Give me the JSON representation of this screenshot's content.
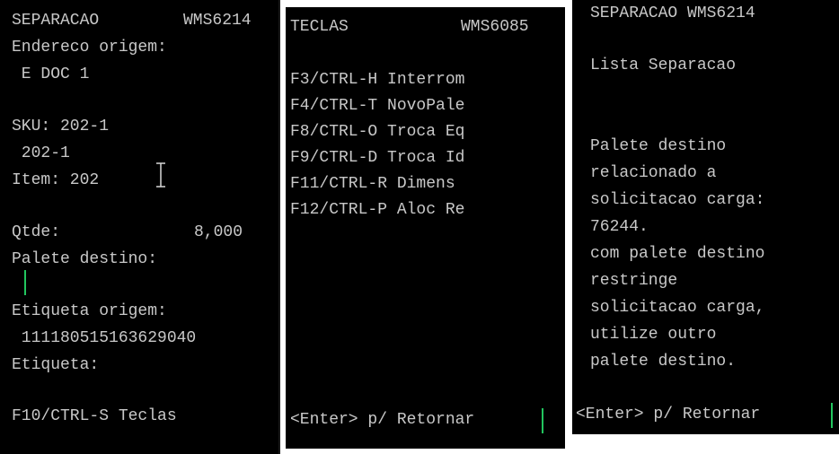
{
  "colors": {
    "background": "#000000",
    "text": "#c8c8c8",
    "cursor": "#22c55e"
  },
  "panel1": {
    "title": "SEPARACAO",
    "code": "WMS6214",
    "endereco_label": "Endereco origem:",
    "endereco_value": " E DOC 1",
    "sku_label": "SKU: 202-1",
    "sku_value": " 202-1",
    "item_label": "Item: 202",
    "qtde_label": "Qtde:",
    "qtde_value": "8,000",
    "palete_label": "Palete destino:",
    "etiqueta_origem_label": "Etiqueta origem:",
    "etiqueta_origem_value": " 111180515163629040",
    "etiqueta_label": "Etiqueta:",
    "footer": "F10/CTRL-S Teclas"
  },
  "panel2": {
    "title": "TECLAS",
    "code": "WMS6085",
    "keys": [
      "F3/CTRL-H Interrom",
      "F4/CTRL-T NovoPale",
      "F8/CTRL-O Troca Eq",
      "F9/CTRL-D Troca Id",
      "F11/CTRL-R Dimens",
      "F12/CTRL-P Aloc Re"
    ],
    "footer": "<Enter> p/ Retornar"
  },
  "panel3": {
    "title": "SEPARACAO WMS6214",
    "subtitle": "Lista Separacao",
    "message": [
      "Palete destino",
      "relacionado a",
      "solicitacao carga:",
      "76244.",
      "com palete destino",
      "restringe",
      "solicitacao carga,",
      "utilize outro",
      "palete destino."
    ],
    "footer": "<Enter> p/ Retornar"
  }
}
